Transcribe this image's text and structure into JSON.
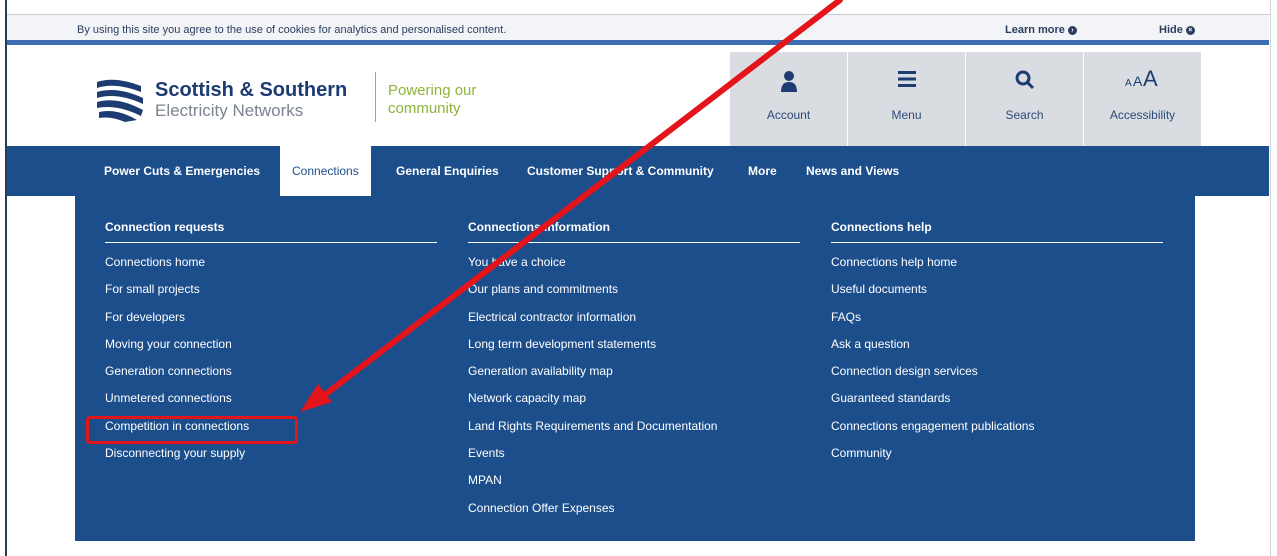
{
  "cookie": {
    "message": "By using this site you agree to the use of cookies for analytics and personalised content.",
    "learn_more": "Learn more",
    "hide": "Hide"
  },
  "header": {
    "brand_line1": "Scottish & Southern",
    "brand_line2": "Electricity Networks",
    "tagline_line1": "Powering our",
    "tagline_line2": "community",
    "tools": [
      {
        "label": "Account",
        "icon": "user-icon"
      },
      {
        "label": "Menu",
        "icon": "menu-icon"
      },
      {
        "label": "Search",
        "icon": "search-icon"
      },
      {
        "label": "Accessibility",
        "icon": "text-size-icon"
      }
    ]
  },
  "nav": {
    "items": [
      "Power Cuts & Emergencies",
      "Connections",
      "General Enquiries",
      "Customer Support & Community",
      "More",
      "News and Views"
    ],
    "active": "Connections"
  },
  "dropdown": {
    "columns": [
      {
        "heading": "Connection requests",
        "links": [
          "Connections home",
          "For small projects",
          "For developers",
          "Moving your connection",
          "Generation connections",
          "Unmetered connections",
          "Competition in connections",
          "Disconnecting your supply"
        ]
      },
      {
        "heading": "Connections information",
        "links": [
          "You have a choice",
          "Our plans and commitments",
          "Electrical contractor information",
          "Long term development statements",
          "Generation availability map",
          "Network capacity map",
          "Land Rights Requirements and Documentation",
          "Events",
          "MPAN",
          "Connection Offer Expenses"
        ]
      },
      {
        "heading": "Connections help",
        "links": [
          "Connections help home",
          "Useful documents",
          "FAQs",
          "Ask a question",
          "Connection design services",
          "Guaranteed standards",
          "Connections engagement publications",
          "Community"
        ]
      }
    ]
  },
  "annotation": {
    "highlighted_item": "Competition in connections",
    "color": "#e4141b"
  }
}
